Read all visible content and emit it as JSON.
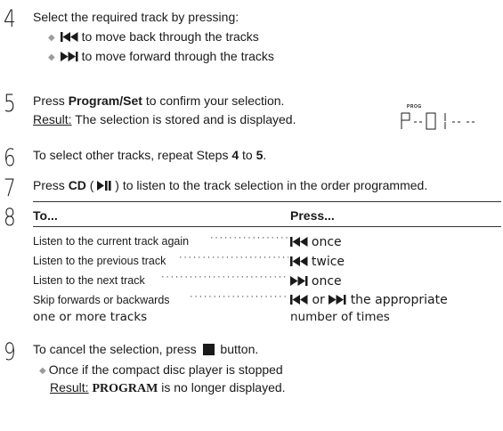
{
  "steps": {
    "s4": {
      "num": "4",
      "text": "Select the required track by pressing:",
      "bullet1": "to move back through the tracks",
      "bullet2": "to move forward through the tracks"
    },
    "s5": {
      "num": "5",
      "line1_pre": "Press ",
      "line1_bold": "Program/Set",
      "line1_post": " to confirm your selection.",
      "result_label": "Result:",
      "result_text": " The selection is stored and is displayed.",
      "lcd_small": "PROG",
      "lcd_text": "P -- 0 1 -- --"
    },
    "s6": {
      "num": "6",
      "pre": "To select other tracks, repeat Steps ",
      "b1": "4",
      "mid": " to ",
      "b2": "5",
      "post": "."
    },
    "s7": {
      "num": "7",
      "pre": "Press ",
      "bold": "CD",
      "mid": " ( ",
      "post": " ) to listen to the track selection in the order programmed."
    },
    "s8": {
      "num": "8",
      "col1_header": "To...",
      "col2_header": "Press...",
      "rows": [
        {
          "label": "Listen to the current track again",
          "press": "once"
        },
        {
          "label": "Listen to the previous track",
          "press": "twice"
        },
        {
          "label": "Listen to the next track",
          "press": "once"
        },
        {
          "label": "Skip forwards or backwards",
          "press_pre": "",
          "or": "or",
          "press": "the appropriate",
          "label2": "one or more tracks",
          "press2": "number of times"
        }
      ]
    },
    "s9": {
      "num": "9",
      "pre": "To cancel the selection, press ",
      "post": " button.",
      "bullet": "Once if the compact disc player is stopped",
      "result_label": "Result:",
      "result_bold": "PROGRAM",
      "result_text": " is no longer displayed."
    }
  },
  "icons": {
    "prev": "skip-back-icon",
    "next": "skip-forward-icon",
    "play_pause": "play-pause-icon",
    "stop": "stop-icon",
    "bullet": "diamond-bullet-icon"
  }
}
